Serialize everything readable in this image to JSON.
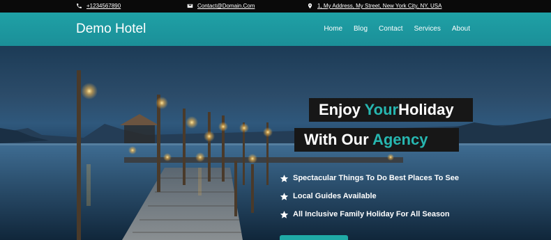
{
  "topbar": {
    "phone": "+1234567890",
    "email": "Contact@Domain.Com",
    "address": "1, My Address, My Street, New York City, NY, USA"
  },
  "header": {
    "brand": "Demo Hotel",
    "nav": [
      "Home",
      "Blog",
      "Contact",
      "Services",
      "About"
    ]
  },
  "hero": {
    "line1_prefix": "Enjoy ",
    "line1_accent": "Your",
    "line1_suffix": "Holiday",
    "line2_prefix": "With Our ",
    "line2_accent": "Agency",
    "features": [
      "Spectacular Things To Do Best Places To See",
      "Local Guides Available",
      "All Inclusive Family Holiday For All Season"
    ]
  },
  "colors": {
    "accent": "#27b6b0",
    "header": "#1fa1a6",
    "topbar": "#0a0a0a"
  }
}
